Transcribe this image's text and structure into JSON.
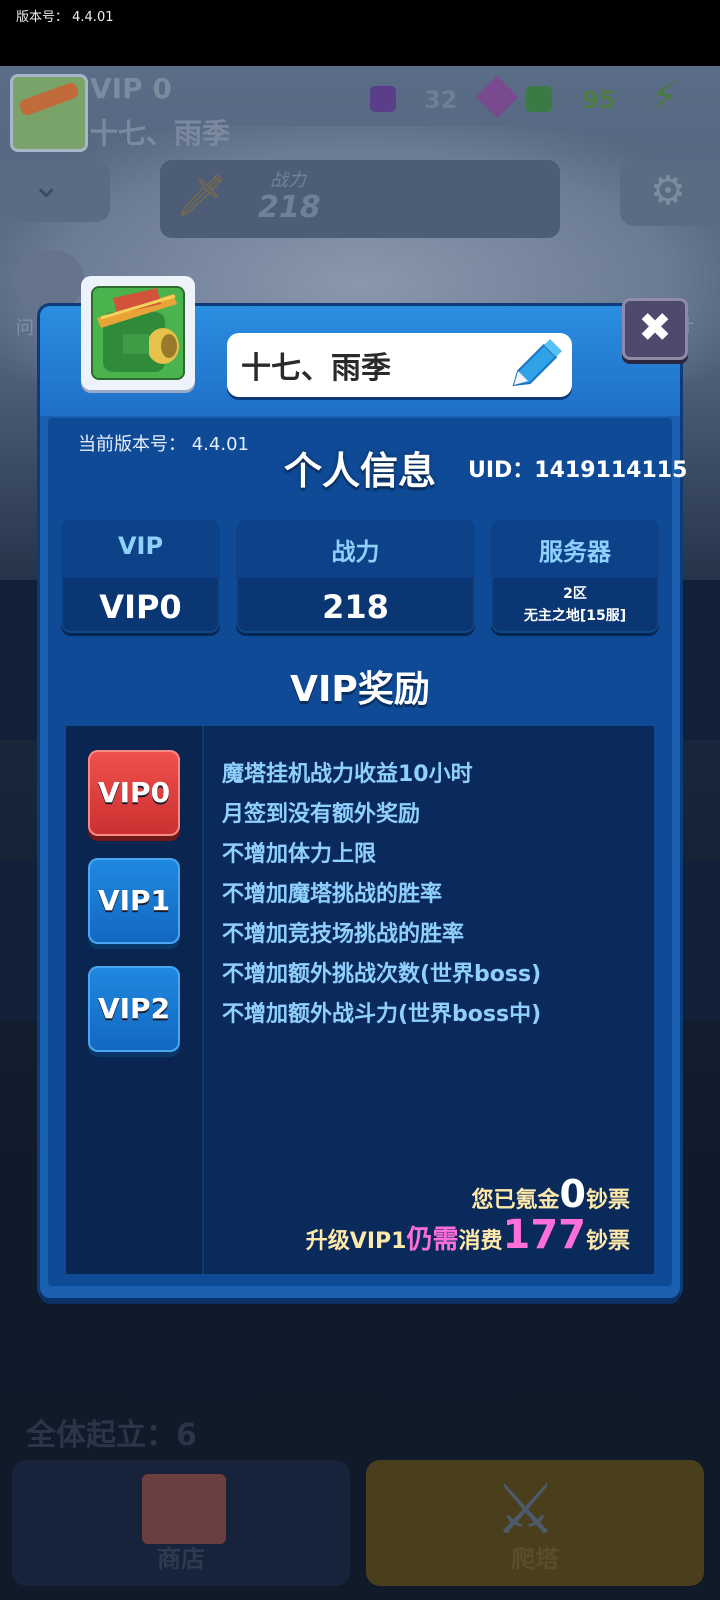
{
  "system": {
    "version_label": "版本号： 4.4.01"
  },
  "background": {
    "vip": "VIP 0",
    "name": "十七、雨季",
    "res1": "32",
    "res2": "95",
    "power_label": "战力",
    "power_value": "218",
    "chat_label": "问",
    "lock_label": "计",
    "stand_label": "全体起立：6",
    "shop_label": "商店",
    "tower_label": "爬塔"
  },
  "modal": {
    "name": "十七、雨季",
    "current_version": "当前版本号：  4.4.01",
    "title": "个人信息",
    "uid": "UID：1419114115",
    "stats": {
      "vip_label": "VIP",
      "vip_value": "VIP0",
      "power_label": "战力",
      "power_value": "218",
      "server_label": "服务器",
      "server_line1": "2区",
      "server_line2": "无主之地[15服]"
    },
    "vip_section_title": "VIP奖励",
    "vip_tabs": [
      "VIP0",
      "VIP1",
      "VIP2"
    ],
    "selected_tab": "VIP0",
    "perks": [
      "魔塔挂机战力收益10小时",
      "月签到没有额外奖励",
      "不增加体力上限",
      "不增加魔塔挑战的胜率",
      "不增加竞技场挑战的胜率",
      "不增加额外挑战次数(世界boss)",
      "不增加额外战斗力(世界boss中)"
    ],
    "spent_prefix": "您已氪金",
    "spent_amount": "0",
    "spent_unit": "钞票",
    "need_prefix": "升级VIP1",
    "need_mid": "仍需",
    "need_consume": "消费",
    "need_amount": "177",
    "need_unit": "钞票"
  },
  "colors": {
    "accent_blue": "#1a5fb0",
    "vip_active": "#e0403d",
    "perk_text": "#8fd0ff",
    "highlight": "#ff6fd8"
  },
  "icons": [
    "pencil-icon",
    "close-icon",
    "gear-icon",
    "chevron-down-icon",
    "sword-icon",
    "gem-icon",
    "lightning-icon",
    "avatar-image"
  ]
}
